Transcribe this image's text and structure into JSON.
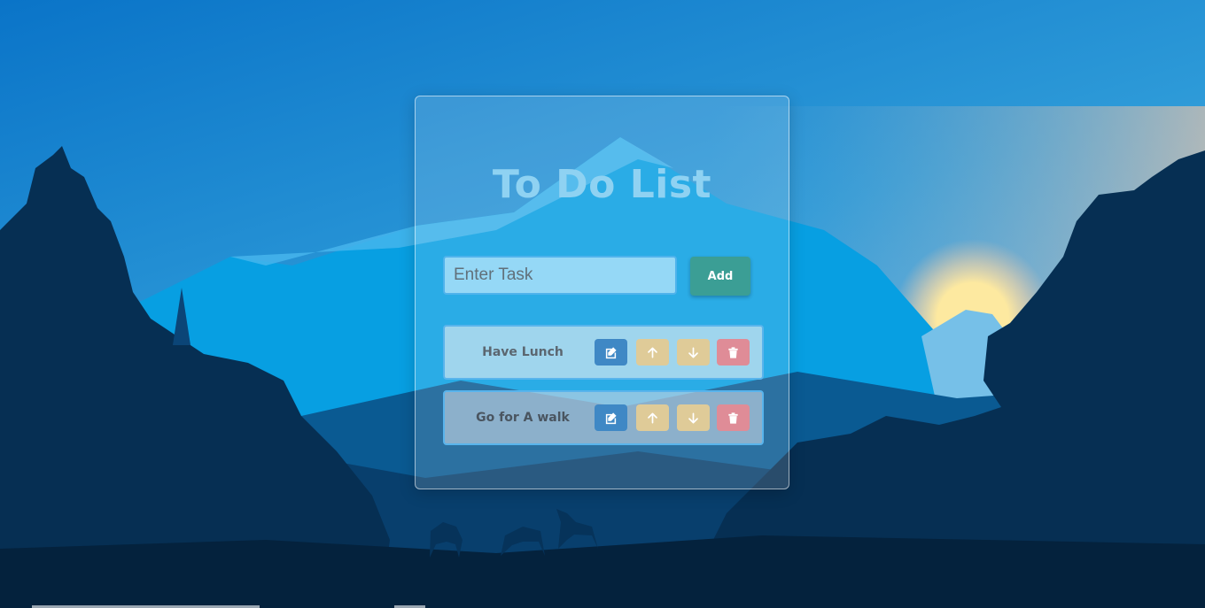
{
  "app": {
    "title": "To Do List"
  },
  "input": {
    "placeholder": "Enter Task",
    "value": ""
  },
  "add_button": {
    "label": "Add"
  },
  "tasks": [
    {
      "label": "Have Lunch"
    },
    {
      "label": "Go for A walk"
    }
  ],
  "colors": {
    "title": "#8fd2f2",
    "add_button": "#3b9e95",
    "edit_button": "#3f88c5",
    "move_buttons": "#dfcb98",
    "delete_button": "#df8c97",
    "item_border": "#59b4ec"
  },
  "icons": {
    "edit": "edit-icon",
    "up": "arrow-up-icon",
    "down": "arrow-down-icon",
    "delete": "trash-icon"
  }
}
